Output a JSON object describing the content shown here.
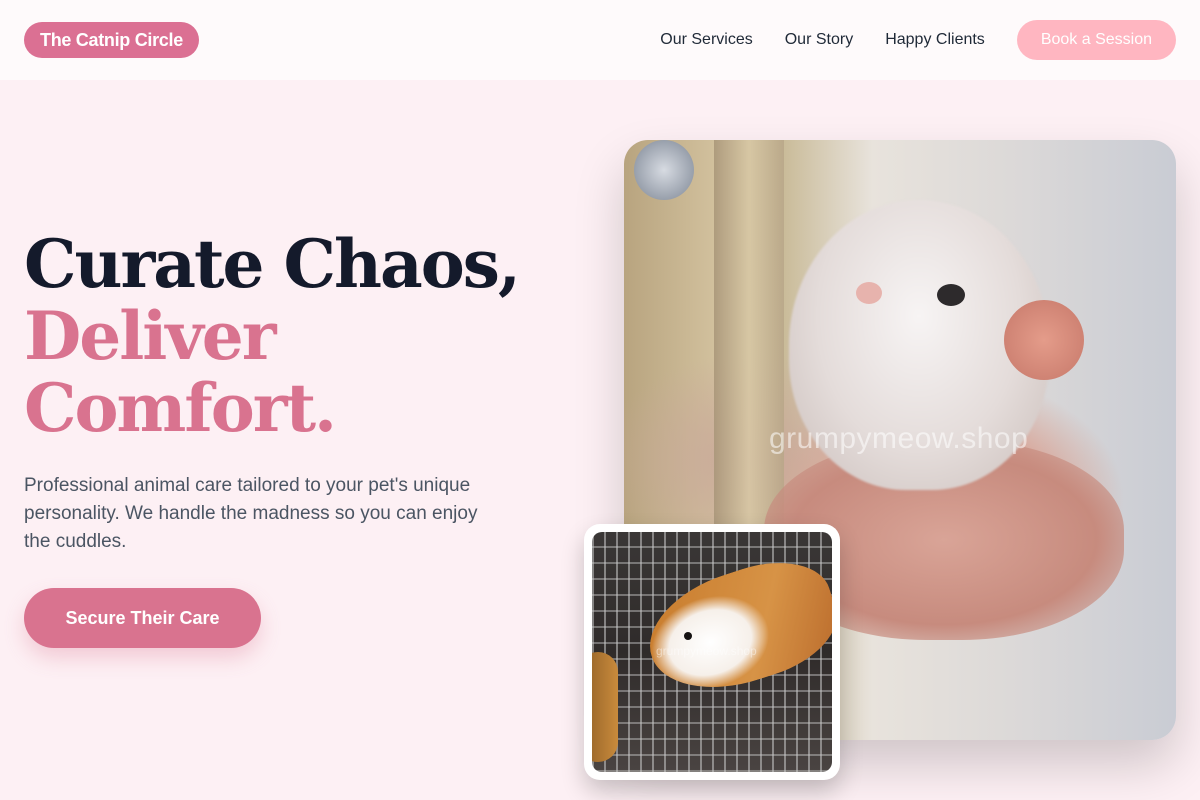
{
  "header": {
    "logo": "The Catnip Circle",
    "nav": [
      "Our Services",
      "Our Story",
      "Happy Clients"
    ],
    "cta": "Book a Session"
  },
  "hero": {
    "headline_line1": "Curate Chaos,",
    "headline_line2": "Deliver",
    "headline_line3": "Comfort.",
    "description": "Professional animal care tailored to your pet's unique personality. We handle the madness so you can enjoy the cuddles.",
    "cta": "Secure Their Care"
  },
  "images": {
    "main_watermark": "grumpymeow.shop",
    "secondary_watermark": "grumpymeow.shop"
  },
  "colors": {
    "accent": "#db7093",
    "accent_light": "#ffb6c1",
    "background": "#fdf0f4",
    "heading_dark": "#141a2b"
  }
}
